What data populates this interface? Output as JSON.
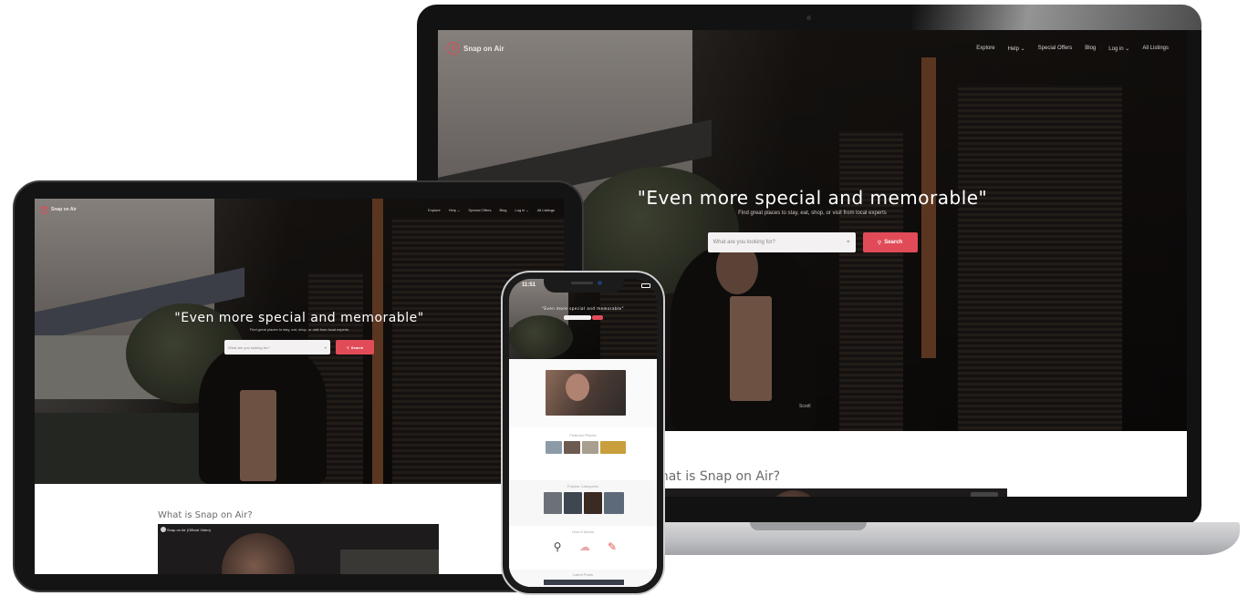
{
  "site": {
    "brand": "Snap on Air",
    "logo_mark": "S",
    "nav": [
      "Explore",
      "Help ⌄",
      "Special Offers",
      "Blog",
      "Log in ⌄",
      "All Listings"
    ],
    "tagline": "\"Even more special and memorable\"",
    "subtagline": "Find great places to stay, eat, shop, or visit from local experts",
    "search_placeholder": "What are you looking for?",
    "search_button": "Search",
    "search_icon": "magnifier-icon",
    "section_heading": "What is Snap on Air?",
    "video_title": "Snap on Air (Official Video)",
    "scroll_hint": "Scroll"
  },
  "phone": {
    "status_time": "11:51",
    "sections": [
      "Featured Places",
      "Popular Categories",
      "How It Works",
      "Latest Posts"
    ]
  },
  "devices": [
    "laptop",
    "tablet",
    "phone"
  ],
  "colors": {
    "accent": "#e04b57",
    "hero_dark": "#15110f",
    "search_bg": "#f3f1f1",
    "section_bg": "#ffffff",
    "bezel": "#121212",
    "laptop_base": "#c0c1c4"
  }
}
